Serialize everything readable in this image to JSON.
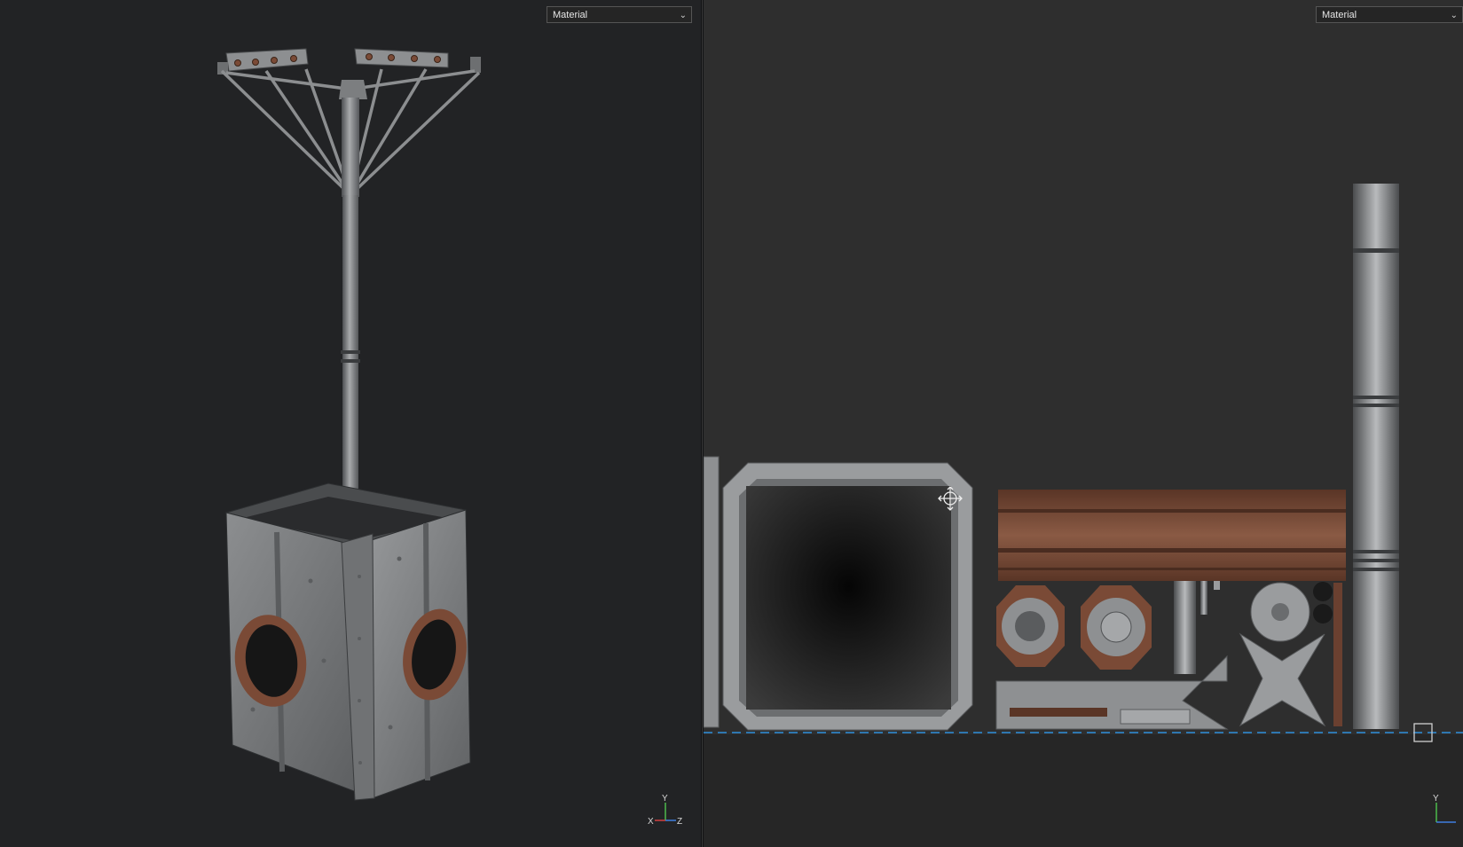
{
  "viewports": {
    "left": {
      "name": "3D view",
      "shading_mode": "Material",
      "gizmo": {
        "up": "Y",
        "left": "X",
        "right": "Z"
      }
    },
    "right": {
      "name": "UV/2D view",
      "shading_mode": "Material",
      "gizmo": {
        "up": "Y"
      }
    }
  },
  "colors": {
    "viewport_3d_bg": "#222325",
    "viewport_2d_bg": "#2e2e2e",
    "metal": "#8a8c8e",
    "copper": "#7a4a36",
    "uv_baseline": "#2f8fdc"
  },
  "icons": [
    "chevron-down-icon",
    "move-cursor-icon",
    "axis-gizmo-icon",
    "square-marker-icon"
  ]
}
